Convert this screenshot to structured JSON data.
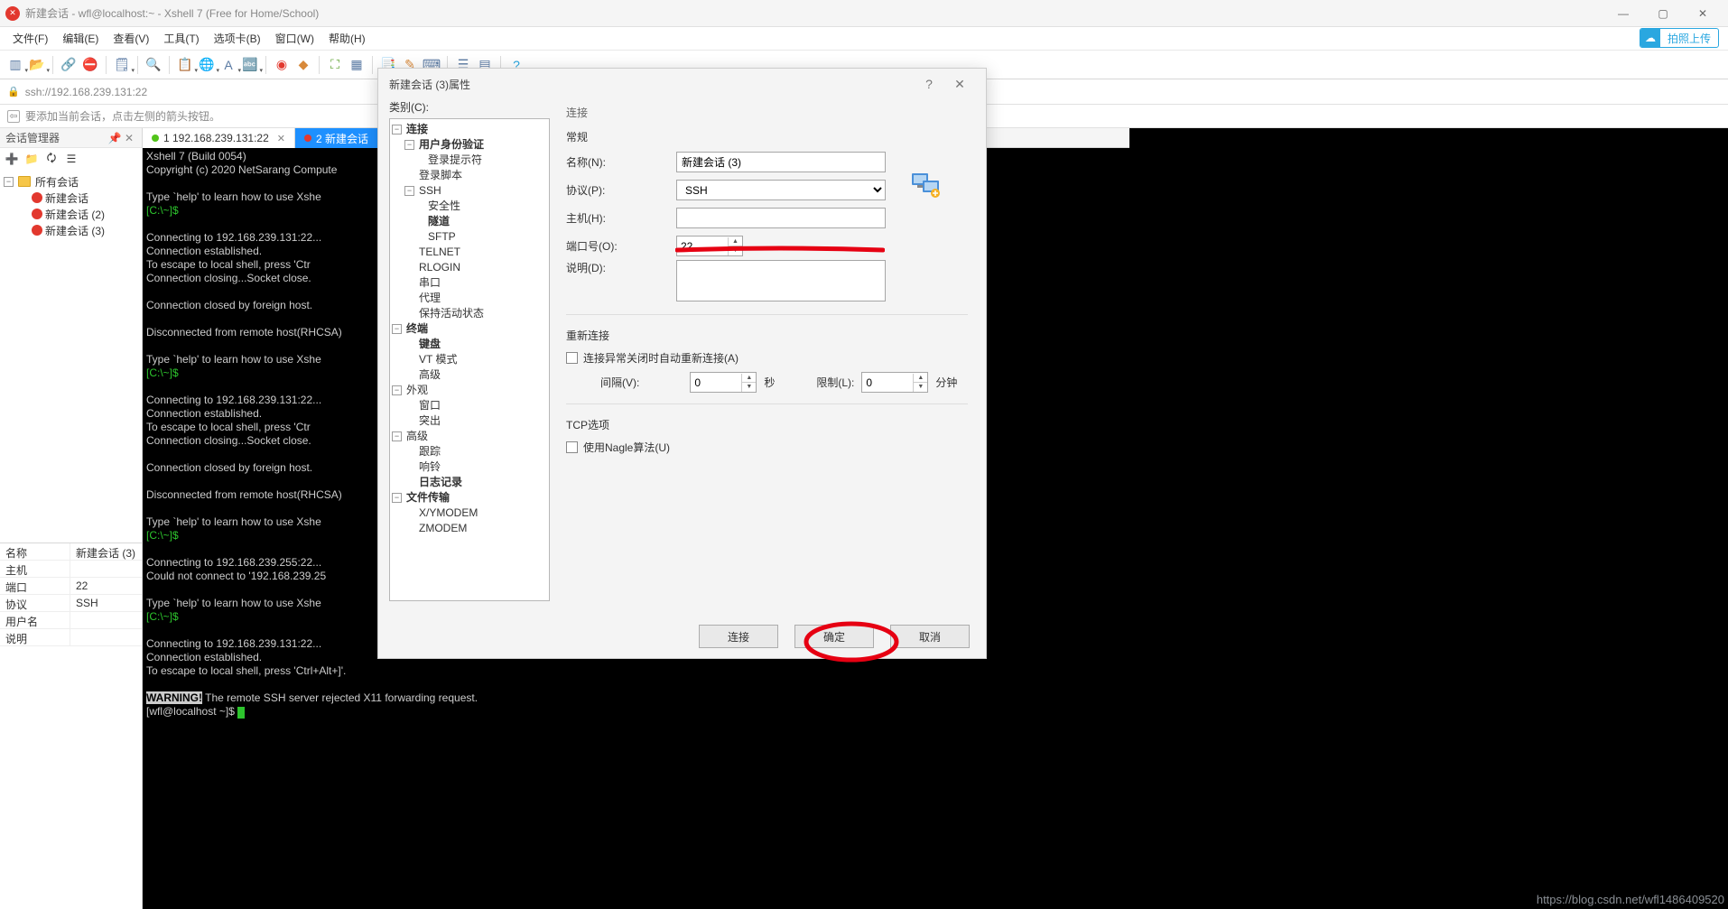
{
  "window": {
    "title": "新建会话 - wfl@localhost:~ - Xshell 7 (Free for Home/School)"
  },
  "menu": [
    "文件(F)",
    "编辑(E)",
    "查看(V)",
    "工具(T)",
    "选项卡(B)",
    "窗口(W)",
    "帮助(H)"
  ],
  "uploadBtn": "拍照上传",
  "address": {
    "url": "ssh://192.168.239.131:22"
  },
  "tip": "要添加当前会话，点击左侧的箭头按钮。",
  "sessionPanel": {
    "title": "会话管理器",
    "root": "所有会话",
    "items": [
      "新建会话",
      "新建会话 (2)",
      "新建会话 (3)"
    ],
    "props": {
      "nameK": "名称",
      "nameV": "新建会话 (3)",
      "hostK": "主机",
      "hostV": "",
      "portK": "端口",
      "portV": "22",
      "protoK": "协议",
      "protoV": "SSH",
      "userK": "用户名",
      "userV": "",
      "descK": "说明",
      "descV": ""
    }
  },
  "tabs": {
    "t1": "1 192.168.239.131:22",
    "t2": "2 新建会话"
  },
  "terminal": {
    "l1": "Xshell 7 (Build 0054)",
    "l2": "Copyright (c) 2020 NetSarang Compute",
    "l3": "Type `help' to learn how to use Xshe",
    "p1": "[C:\\~]$",
    "l4": "Connecting to 192.168.239.131:22...",
    "l5": "Connection established.",
    "l6": "To escape to local shell, press 'Ctr",
    "l7": "Connection closing...Socket close.",
    "l8": "Connection closed by foreign host.",
    "l9": "Disconnected from remote host(RHCSA)",
    "l10": "Connecting to 192.168.239.255:22...",
    "l11": "Could not connect to '192.168.239.25",
    "l12": "Connecting to 192.168.239.131:22...",
    "l13": "Connection established.",
    "l14": "To escape to local shell, press 'Ctrl+Alt+]'.",
    "warn": "WARNING!",
    "l15": " The remote SSH server rejected X11 forwarding request.",
    "l16": "[wfl@localhost ~]$ "
  },
  "dialog": {
    "title": "新建会话 (3)属性",
    "catLabel": "类别(C):",
    "tree": {
      "connection": "连接",
      "auth": "用户身份验证",
      "loginPrompt": "登录提示符",
      "loginScript": "登录脚本",
      "ssh": "SSH",
      "security": "安全性",
      "tunnel": "隧道",
      "sftp": "SFTP",
      "telnet": "TELNET",
      "rlogin": "RLOGIN",
      "serial": "串口",
      "proxy": "代理",
      "keepalive": "保持活动状态",
      "terminal": "终端",
      "keyboard": "键盘",
      "vtmode": "VT 模式",
      "advancedT": "高级",
      "appearance": "外观",
      "windowA": "窗口",
      "highlight": "突出",
      "advanced": "高级",
      "trace": "跟踪",
      "bell": "响铃",
      "logging": "日志记录",
      "filetransfer": "文件传输",
      "xymodem": "X/YMODEM",
      "zmodem": "ZMODEM"
    },
    "form": {
      "connHd": "连接",
      "general": "常规",
      "nameL": "名称(N):",
      "nameV": "新建会话 (3)",
      "protoL": "协议(P):",
      "protoV": "SSH",
      "hostL": "主机(H):",
      "hostV": "",
      "portL": "端口号(O):",
      "portV": "22",
      "descL": "说明(D):",
      "descV": "",
      "reconnect": "重新连接",
      "autoReconnect": "连接异常关闭时自动重新连接(A)",
      "intervalL": "间隔(V):",
      "intervalV": "0",
      "sec": "秒",
      "limitL": "限制(L):",
      "limitV": "0",
      "min": "分钟",
      "tcp": "TCP选项",
      "nagle": "使用Nagle算法(U)"
    },
    "buttons": {
      "connect": "连接",
      "ok": "确定",
      "cancel": "取消"
    }
  },
  "watermark": "https://blog.csdn.net/wfl1486409520"
}
